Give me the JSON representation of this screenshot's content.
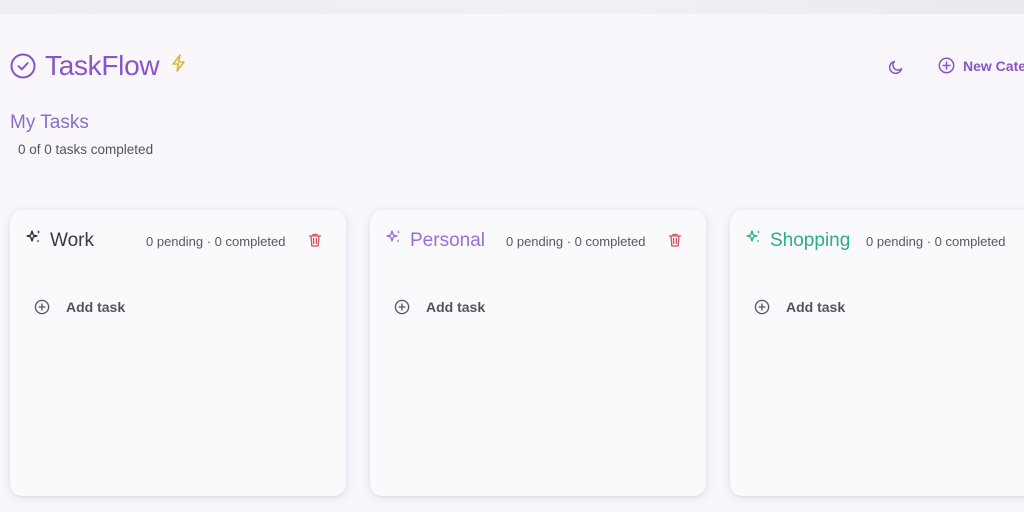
{
  "app": {
    "title": "TaskFlow",
    "brand_color": "#8a55c7"
  },
  "header": {
    "theme_toggle_icon": "moon-icon",
    "new_category_label": "New Categ"
  },
  "main": {
    "title": "My Tasks",
    "summary": "0 of 0 tasks completed"
  },
  "categories": [
    {
      "name": "Work",
      "counts": "0 pending · 0 completed",
      "add_label": "Add task",
      "color": "#3b3846",
      "icon": "sparkles-icon"
    },
    {
      "name": "Personal",
      "counts": "0 pending · 0 completed",
      "add_label": "Add task",
      "color": "#9a6fd0",
      "icon": "sparkles-icon"
    },
    {
      "name": "Shopping",
      "counts": "0 pending · 0 completed",
      "add_label": "Add task",
      "color": "#2fae86",
      "icon": "sparkles-icon"
    }
  ],
  "colors": {
    "delete": "#d0525a",
    "accent_bolt": "#e3b230"
  }
}
